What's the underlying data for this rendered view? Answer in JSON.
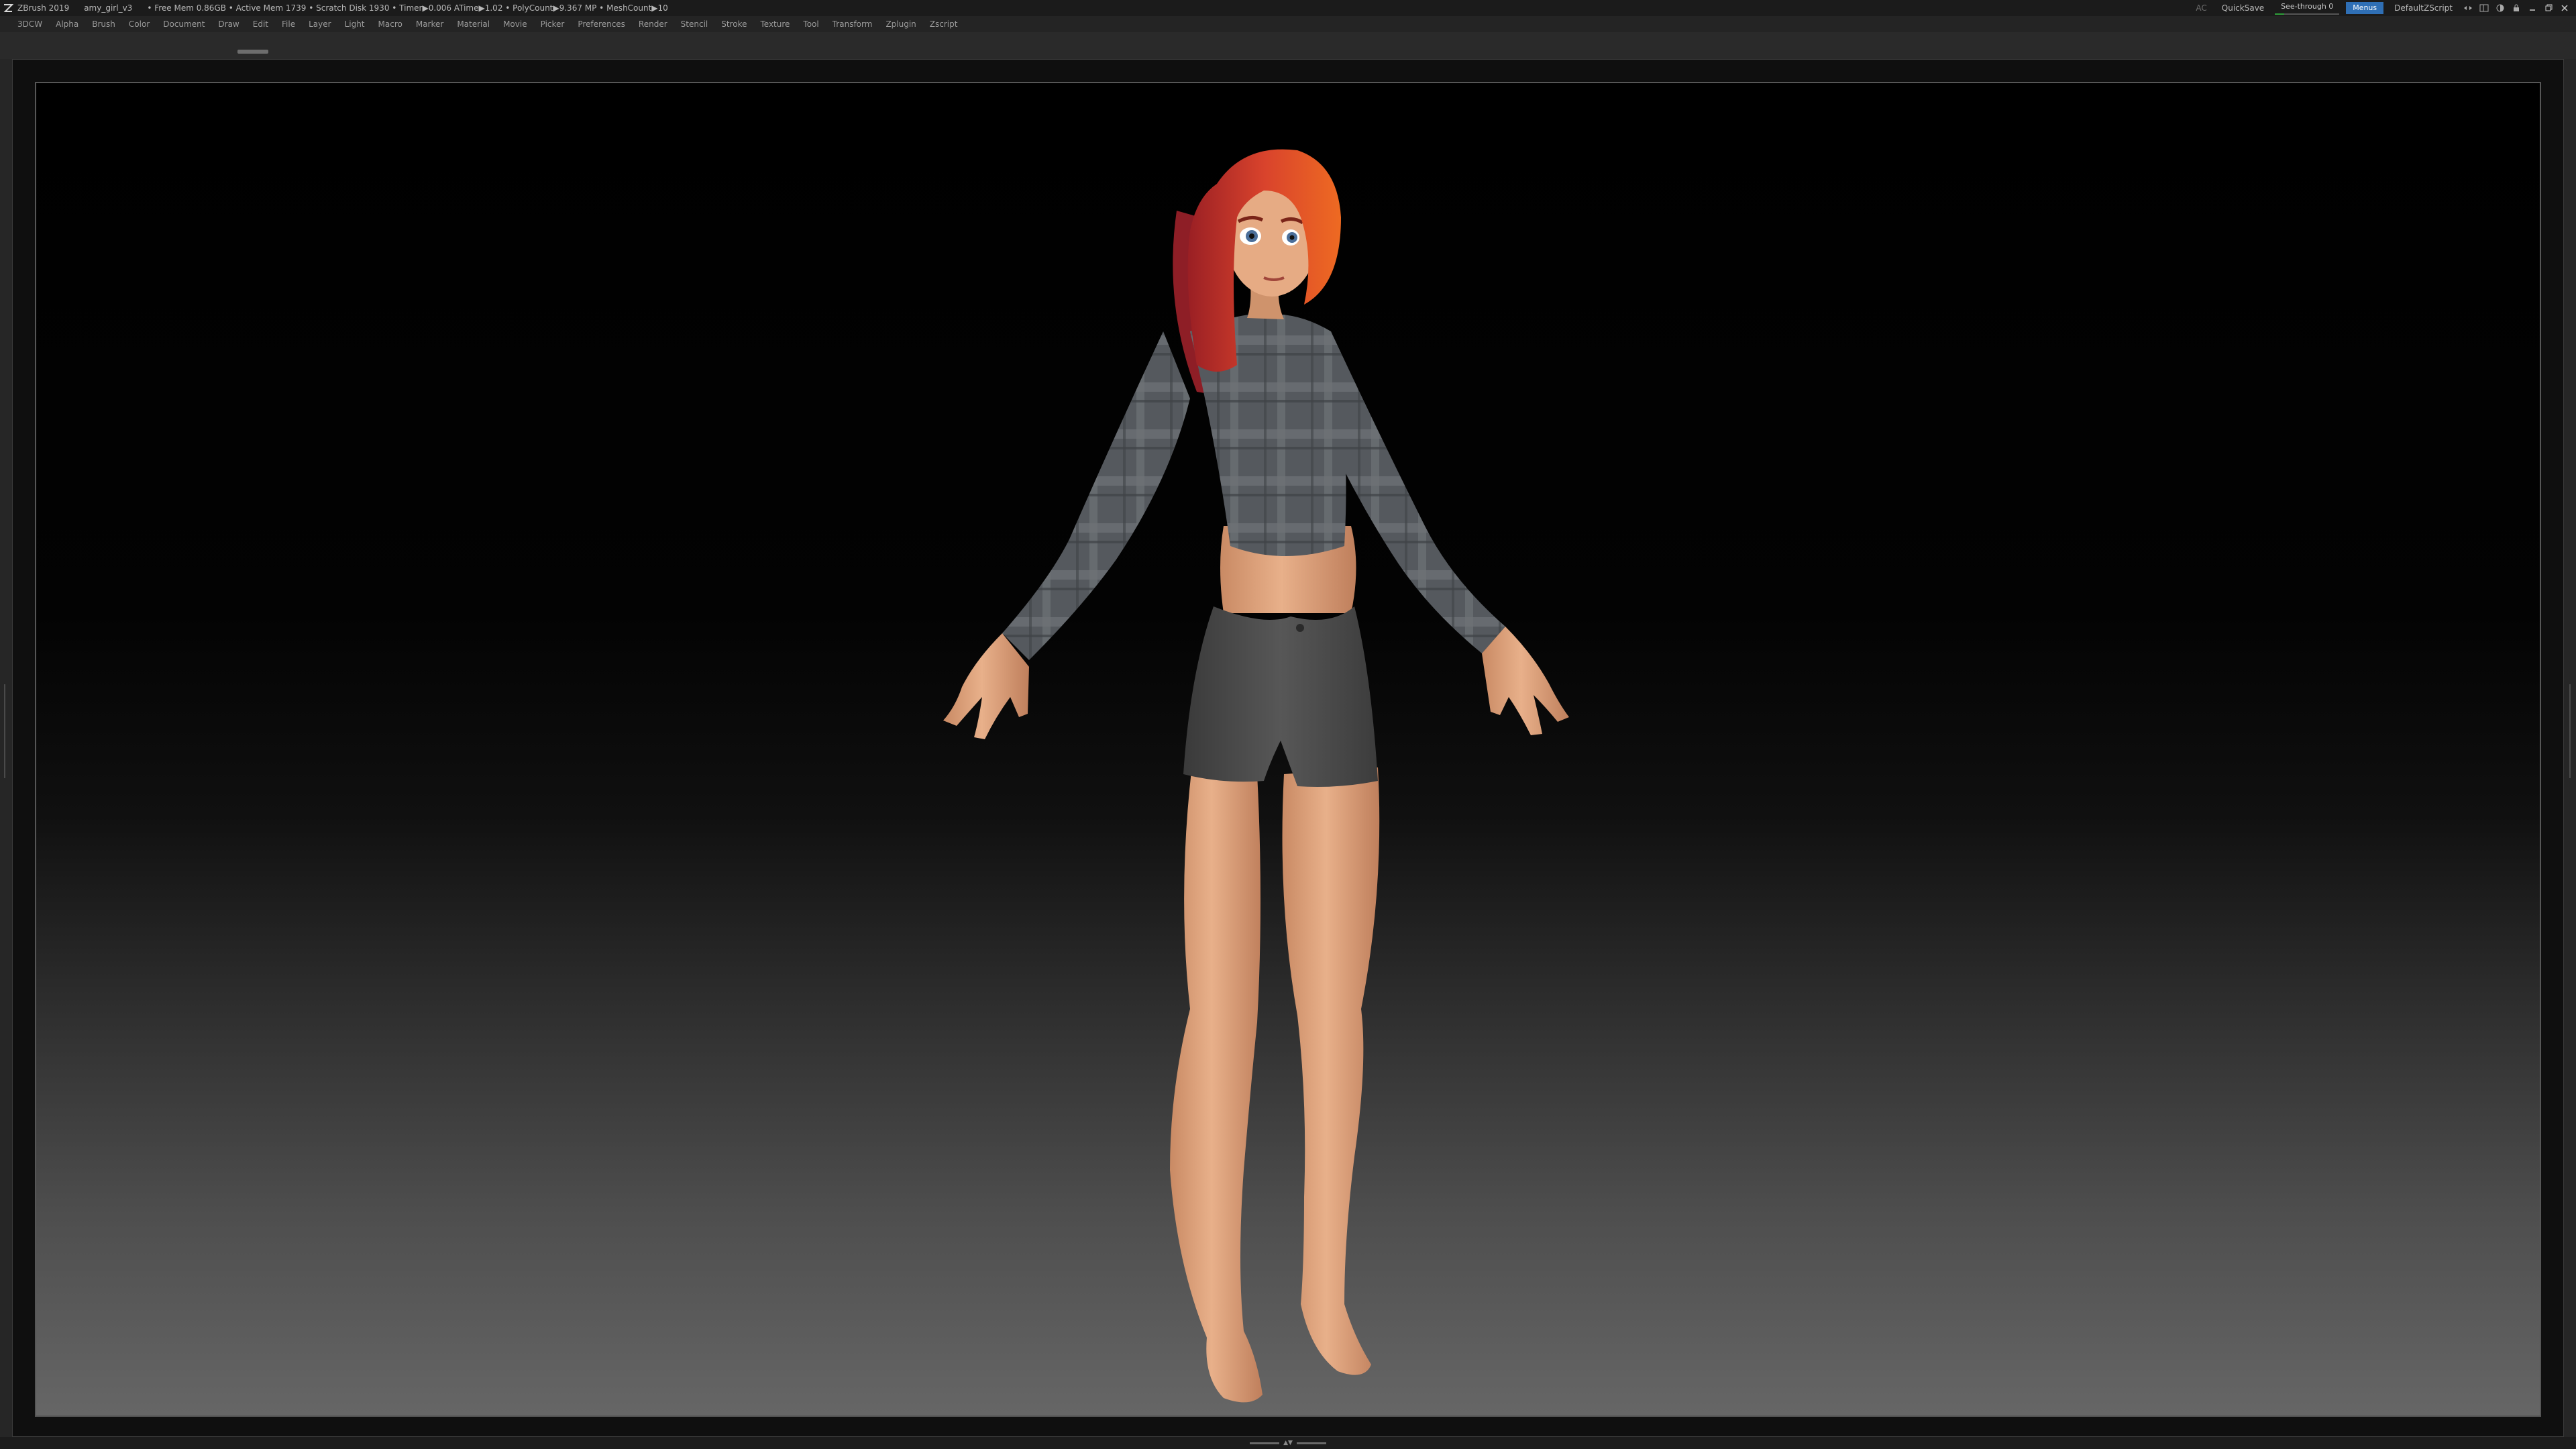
{
  "titlebar": {
    "app_name": "ZBrush 2019",
    "document_name": "amy_girl_v3",
    "stats": "• Free Mem 0.86GB • Active Mem 1739 • Scratch Disk 1930 •  Timer▶0.006 ATime▶1.02 • PolyCount▶9.367 MP  • MeshCount▶10",
    "ac_label": "AC",
    "quicksave_label": "QuickSave",
    "seethrough_label": "See-through  0",
    "seethrough_value": 0,
    "menus_label": "Menus",
    "script_label": "DefaultZScript",
    "colors": {
      "accent": "#2f6fb5",
      "seethrough_bar": "#2e9e3a"
    }
  },
  "menubar": {
    "items": [
      "3DCW",
      "Alpha",
      "Brush",
      "Color",
      "Document",
      "Draw",
      "Edit",
      "File",
      "Layer",
      "Light",
      "Macro",
      "Marker",
      "Material",
      "Movie",
      "Picker",
      "Preferences",
      "Render",
      "Stencil",
      "Stroke",
      "Texture",
      "Tool",
      "Transform",
      "Zplugin",
      "Zscript"
    ]
  },
  "viewport": {
    "subject": "3D model of a stylized cartoon girl with red-orange hair, grey plaid long-sleeve crop top and dark grey shorts, standing barefoot in A-pose",
    "colors": {
      "skin": "#e0a67e",
      "hair": "#d2412c",
      "shirt": "#5a5e63",
      "shorts": "#4a4a4a"
    }
  },
  "icons": {
    "app": "zbrush-logo-icon",
    "window_controls": [
      "minimize-icon",
      "restore-icon",
      "close-icon"
    ]
  }
}
